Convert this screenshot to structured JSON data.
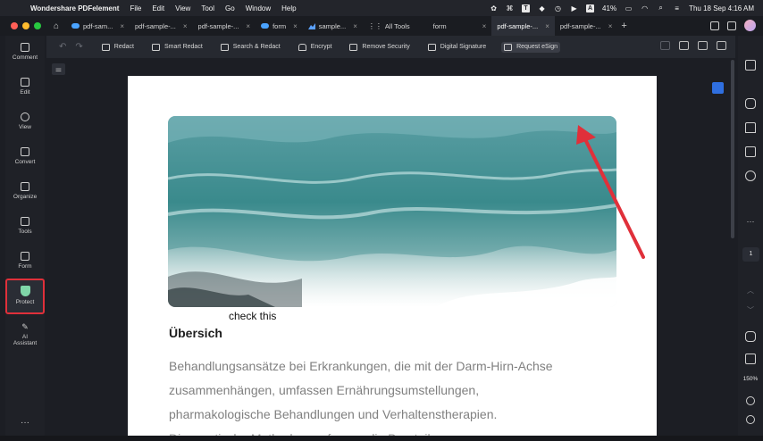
{
  "menubar": {
    "app_name": "Wondershare PDFelement",
    "menus": [
      "File",
      "Edit",
      "View",
      "Tool",
      "Go",
      "Window",
      "Help"
    ],
    "status": {
      "battery": "41%",
      "datetime": "Thu 18 Sep  4:16 AM"
    }
  },
  "tabs": [
    {
      "label": "pdf-sam...",
      "icon": "cloud-icon",
      "active": false
    },
    {
      "label": "pdf-sample-...",
      "icon": "none",
      "active": false
    },
    {
      "label": "pdf-sample-...",
      "icon": "none",
      "active": false
    },
    {
      "label": "form",
      "icon": "cloud-icon",
      "active": false
    },
    {
      "label": "sample...",
      "icon": "chart-icon",
      "active": false
    },
    {
      "label": "All Tools",
      "icon": "grid-icon",
      "active": false
    },
    {
      "label": "form",
      "icon": "none",
      "active": false
    },
    {
      "label": "pdf-sample-...",
      "icon": "none",
      "active": true
    },
    {
      "label": "pdf-sample-...",
      "icon": "none",
      "active": false
    }
  ],
  "left_rail": {
    "items": [
      "Comment",
      "Edit",
      "View",
      "Convert",
      "Organize",
      "Tools",
      "Form",
      "Protect",
      "AI Assistant"
    ],
    "highlight_color": "#e0303a"
  },
  "toolbar": {
    "buttons": [
      "Redact",
      "Smart Redact",
      "Search & Redact",
      "Encrypt",
      "Remove Security",
      "Digital Signature",
      "Request eSign"
    ]
  },
  "document": {
    "annotation": "check this",
    "heading": "Übersich",
    "paragraph_lines": [
      "Behandlungsansätze bei Erkrankungen, die mit der Darm-Hirn-Achse",
      "zusammenhängen, umfassen Ernährungsumstellungen,",
      "pharmakologische Behandlungen und Verhaltenstherapien.",
      "Diagnostische Methoden umfassen die Beurteilung von"
    ]
  },
  "right_rail": {
    "page_number": "1",
    "zoom": "150%"
  },
  "colors": {
    "accent_red": "#e0303a",
    "protect_green": "#7fd6a8",
    "sea_teal": "#3a8a8c"
  }
}
